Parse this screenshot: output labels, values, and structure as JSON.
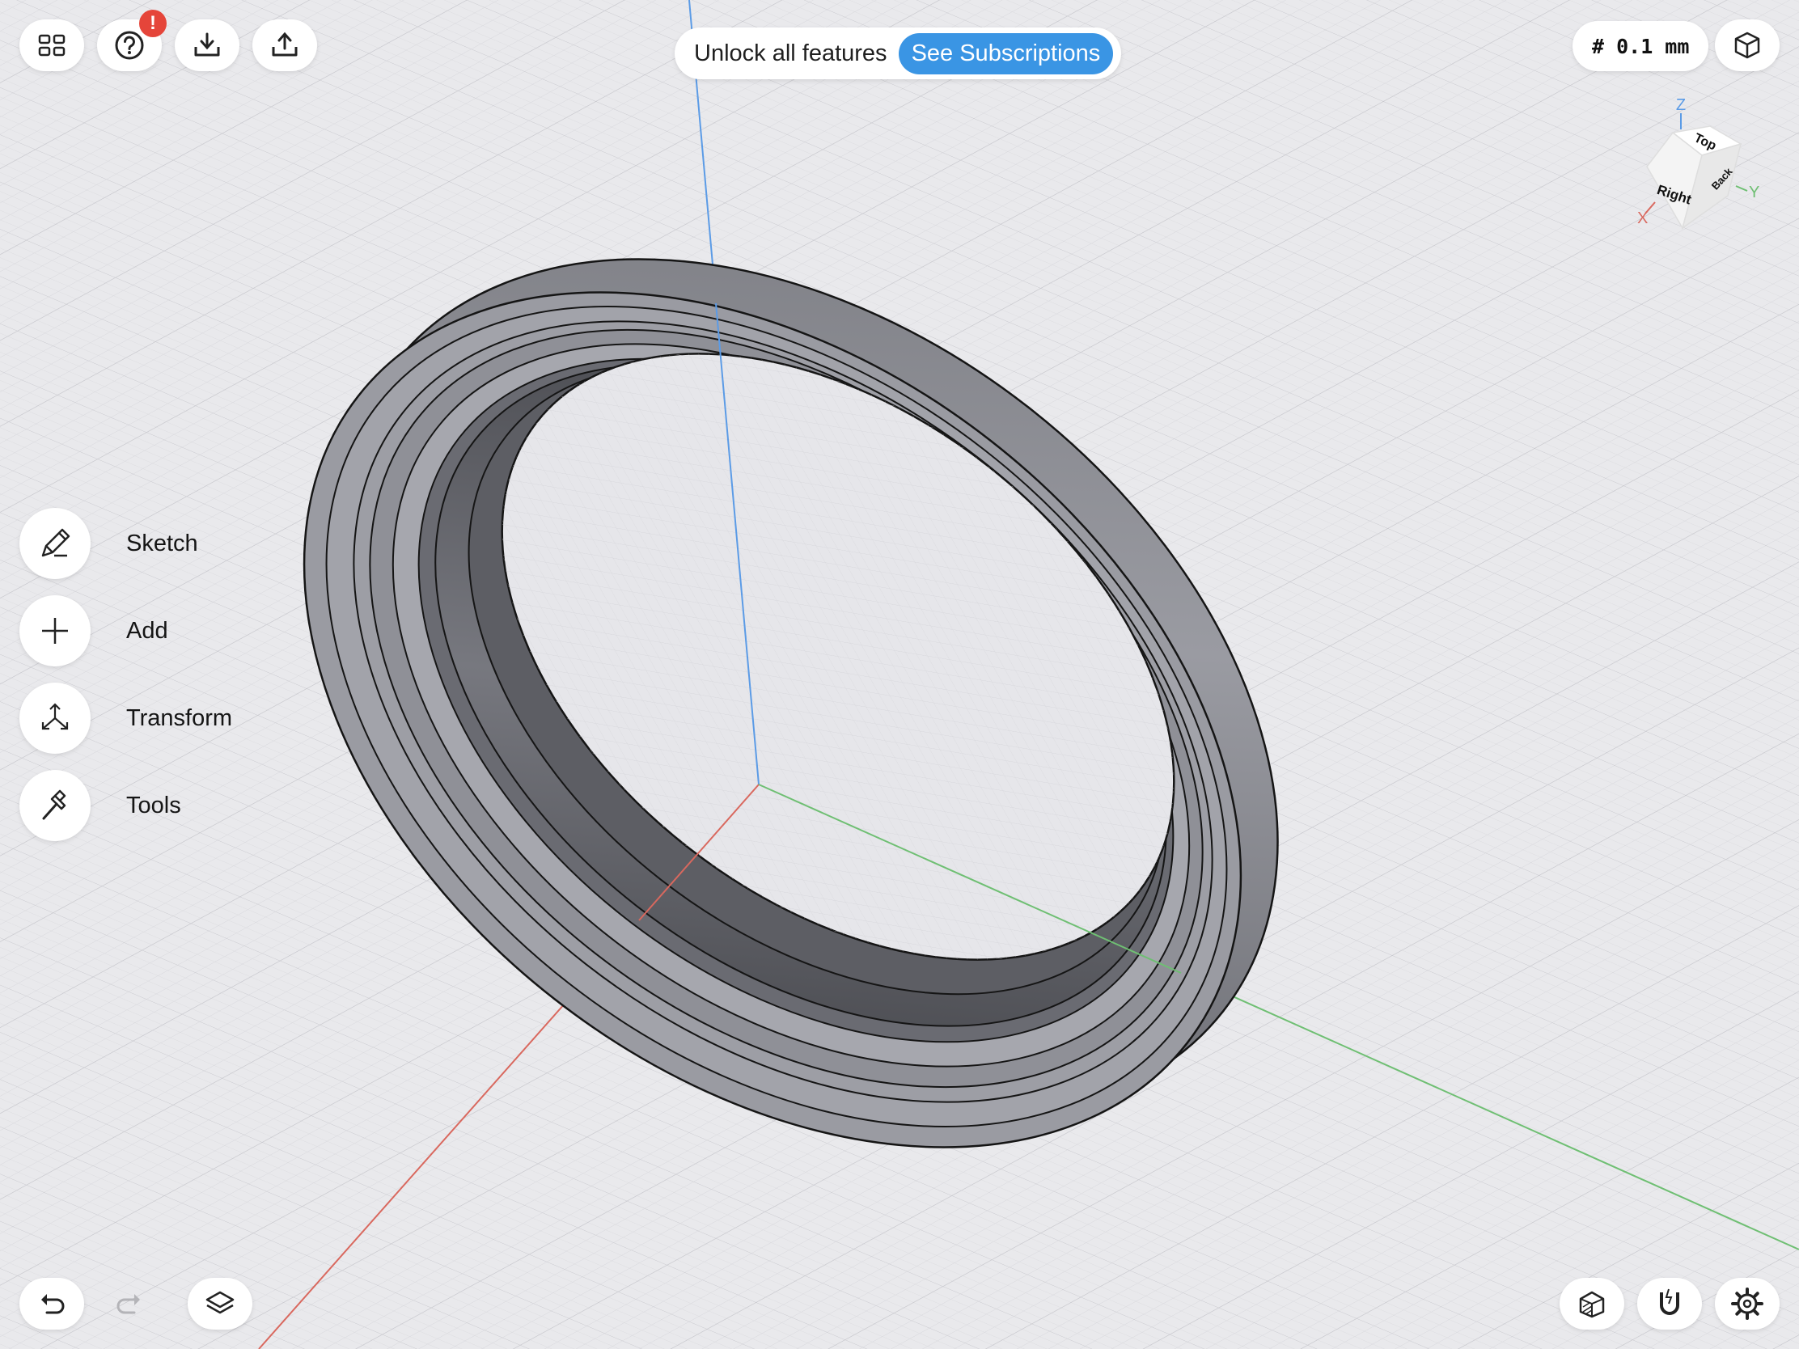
{
  "toolbar": {
    "left_icons": [
      "grid-icon",
      "help-icon",
      "import-icon",
      "export-icon"
    ],
    "help_badge": "!",
    "badge_color": "#e5453a"
  },
  "promo": {
    "text": "Unlock all features",
    "button_label": "See Subscriptions",
    "button_color": "#3a95e4"
  },
  "grid_size": {
    "label": "# 0.1 mm"
  },
  "view_cube": {
    "faces": {
      "top": "Top",
      "right": "Right",
      "back": "Back"
    },
    "axes": {
      "x": "X",
      "y": "Y",
      "z": "Z"
    },
    "axis_colors": {
      "x": "#d9685e",
      "y": "#6fbf73",
      "z": "#5b9be6"
    }
  },
  "sidebar": {
    "items": [
      {
        "label": "Sketch",
        "icon": "pencil-icon"
      },
      {
        "label": "Add",
        "icon": "plus-icon"
      },
      {
        "label": "Transform",
        "icon": "transform-arrows-icon"
      },
      {
        "label": "Tools",
        "icon": "hammer-icon"
      }
    ]
  },
  "bottom_bar": {
    "left_icons": [
      "undo-icon",
      "redo-icon",
      "layers-icon"
    ],
    "right_icons": [
      "section-view-icon",
      "snap-magnet-icon",
      "settings-gear-icon"
    ]
  },
  "scene": {
    "background": "#e9e9ec",
    "model": "ring",
    "model_color": "#8f9098"
  }
}
